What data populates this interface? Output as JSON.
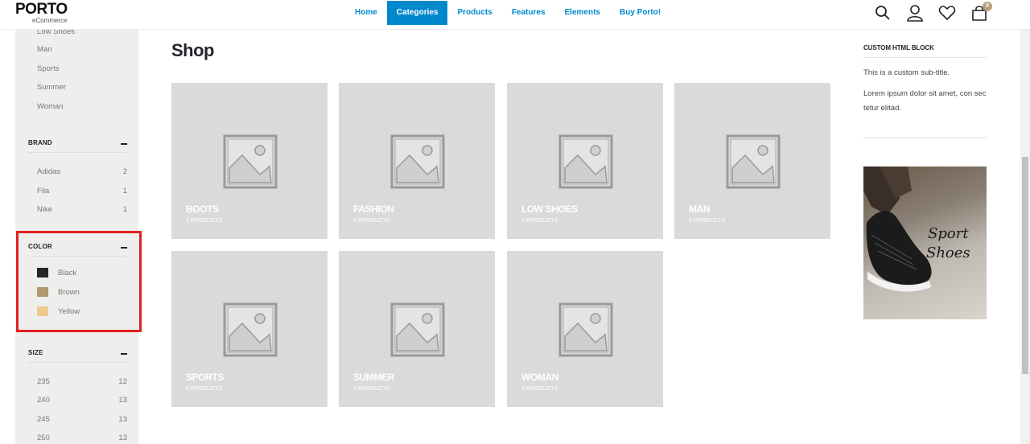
{
  "header": {
    "logo": "PORTO",
    "logo_sub": "eCommerce",
    "nav": [
      "Home",
      "Categories",
      "Products",
      "Features",
      "Elements",
      "Buy Porto!"
    ],
    "active_nav": "Categories",
    "cart_count": "0",
    "icons": [
      "search-icon",
      "user-icon",
      "heart-icon",
      "cart-icon"
    ]
  },
  "sidebar": {
    "categories": [
      "Low Shoes",
      "Man",
      "Sports",
      "Summer",
      "Woman"
    ],
    "brand": {
      "title": "BRAND",
      "items": [
        {
          "name": "Adidas",
          "count": "2"
        },
        {
          "name": "Fila",
          "count": "1"
        },
        {
          "name": "Nike",
          "count": "1"
        }
      ]
    },
    "color": {
      "title": "COLOR",
      "items": [
        {
          "name": "Black",
          "hex": "#222529"
        },
        {
          "name": "Brown",
          "hex": "#b09a6e"
        },
        {
          "name": "Yellow",
          "hex": "#ecc98e"
        }
      ]
    },
    "size": {
      "title": "SIZE",
      "items": [
        {
          "name": "235",
          "count": "12"
        },
        {
          "name": "240",
          "count": "13"
        },
        {
          "name": "245",
          "count": "13"
        },
        {
          "name": "250",
          "count": "13"
        }
      ]
    }
  },
  "main": {
    "title": "Shop",
    "categories": [
      {
        "name": "BOOTS",
        "count": "2 PRODUCTS"
      },
      {
        "name": "FASHION",
        "count": "4 PRODUCTS"
      },
      {
        "name": "LOW SHOES",
        "count": "2 PRODUCTS"
      },
      {
        "name": "MAN",
        "count": "6 PRODUCTS"
      },
      {
        "name": "SPORTS",
        "count": "6 PRODUCTS"
      },
      {
        "name": "SUMMER",
        "count": "2 PRODUCTS"
      },
      {
        "name": "WOMAN",
        "count": "3 PRODUCTS"
      }
    ]
  },
  "right": {
    "block_title": "CUSTOM HTML BLOCK",
    "subtitle": "This is a custom sub-title.",
    "text": "Lorem ipsum dolor sit amet, con sec tetur elitad.",
    "promo_line1": "Sport",
    "promo_line2": "Shoes"
  },
  "colors": {
    "accent": "#0088cc",
    "sidebar_bg": "#eeeeec",
    "tile_bg": "#dadada",
    "highlight": "#e02020"
  }
}
